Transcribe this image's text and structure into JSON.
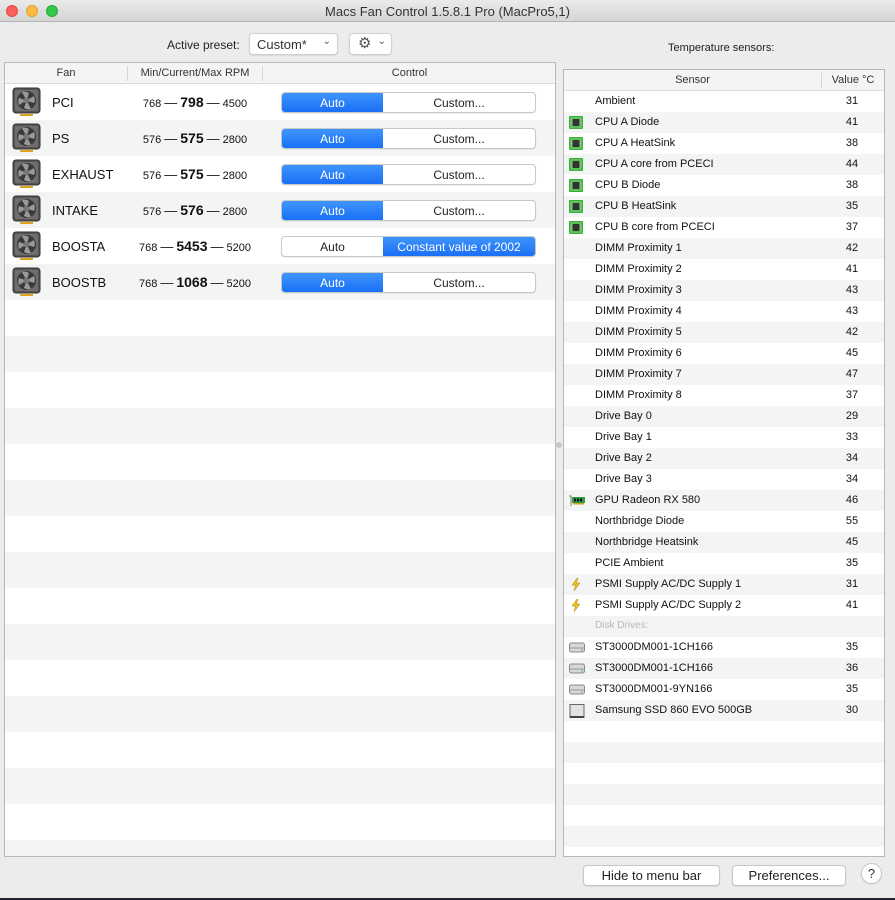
{
  "window": {
    "title": "Macs Fan Control 1.5.8.1 Pro (MacPro5,1)"
  },
  "toolbar": {
    "preset_label": "Active preset:",
    "preset_value": "Custom*",
    "gear_icon": "gear-icon"
  },
  "fans_table": {
    "columns": [
      "Fan",
      "Min/Current/Max RPM",
      "Control"
    ],
    "rows": [
      {
        "name": "PCI",
        "min": "768",
        "current": "798",
        "max": "4500",
        "mode": "auto",
        "auto_label": "Auto",
        "custom_label": "Custom..."
      },
      {
        "name": "PS",
        "min": "576",
        "current": "575",
        "max": "2800",
        "mode": "auto",
        "auto_label": "Auto",
        "custom_label": "Custom..."
      },
      {
        "name": "EXHAUST",
        "min": "576",
        "current": "575",
        "max": "2800",
        "mode": "auto",
        "auto_label": "Auto",
        "custom_label": "Custom..."
      },
      {
        "name": "INTAKE",
        "min": "576",
        "current": "576",
        "max": "2800",
        "mode": "auto",
        "auto_label": "Auto",
        "custom_label": "Custom..."
      },
      {
        "name": "BOOSTA",
        "min": "768",
        "current": "5453",
        "max": "5200",
        "mode": "custom",
        "auto_label": "Auto",
        "custom_label": "Constant value of 2002"
      },
      {
        "name": "BOOSTB",
        "min": "768",
        "current": "1068",
        "max": "5200",
        "mode": "auto",
        "auto_label": "Auto",
        "custom_label": "Custom..."
      }
    ],
    "dash": "—"
  },
  "sensors": {
    "label": "Temperature sensors:",
    "columns": [
      "Sensor",
      "Value °C"
    ],
    "rows": [
      {
        "icon": "none",
        "name": "Ambient",
        "value": "31"
      },
      {
        "icon": "cpu-chip",
        "name": "CPU A Diode",
        "value": "41"
      },
      {
        "icon": "cpu-chip",
        "name": "CPU A HeatSink",
        "value": "38"
      },
      {
        "icon": "cpu-chip",
        "name": "CPU A core from PCECI",
        "value": "44"
      },
      {
        "icon": "cpu-chip",
        "name": "CPU B Diode",
        "value": "38"
      },
      {
        "icon": "cpu-chip",
        "name": "CPU B HeatSink",
        "value": "35"
      },
      {
        "icon": "cpu-chip",
        "name": "CPU B core from PCECI",
        "value": "37"
      },
      {
        "icon": "none",
        "name": "DIMM Proximity 1",
        "value": "42"
      },
      {
        "icon": "none",
        "name": "DIMM Proximity 2",
        "value": "41"
      },
      {
        "icon": "none",
        "name": "DIMM Proximity 3",
        "value": "43"
      },
      {
        "icon": "none",
        "name": "DIMM Proximity 4",
        "value": "43"
      },
      {
        "icon": "none",
        "name": "DIMM Proximity 5",
        "value": "42"
      },
      {
        "icon": "none",
        "name": "DIMM Proximity 6",
        "value": "45"
      },
      {
        "icon": "none",
        "name": "DIMM Proximity 7",
        "value": "47"
      },
      {
        "icon": "none",
        "name": "DIMM Proximity 8",
        "value": "37"
      },
      {
        "icon": "none",
        "name": "Drive Bay 0",
        "value": "29"
      },
      {
        "icon": "none",
        "name": "Drive Bay 1",
        "value": "33"
      },
      {
        "icon": "none",
        "name": "Drive Bay 2",
        "value": "34"
      },
      {
        "icon": "none",
        "name": "Drive Bay 3",
        "value": "34"
      },
      {
        "icon": "gpu-card",
        "name": "GPU Radeon RX 580",
        "value": "46"
      },
      {
        "icon": "none",
        "name": "Northbridge Diode",
        "value": "55"
      },
      {
        "icon": "none",
        "name": "Northbridge Heatsink",
        "value": "45"
      },
      {
        "icon": "none",
        "name": "PCIE Ambient",
        "value": "35"
      },
      {
        "icon": "power-bolt",
        "name": "PSMI Supply AC/DC Supply 1",
        "value": "31"
      },
      {
        "icon": "power-bolt",
        "name": "PSMI Supply AC/DC Supply 2",
        "value": "41"
      },
      {
        "icon": "none",
        "name": "Disk Drives:",
        "value": "",
        "group": true
      },
      {
        "icon": "hard-drive",
        "name": "ST3000DM001-1CH166",
        "value": "35"
      },
      {
        "icon": "hard-drive",
        "name": "ST3000DM001-1CH166",
        "value": "36"
      },
      {
        "icon": "hard-drive",
        "name": "ST3000DM001-9YN166",
        "value": "35"
      },
      {
        "icon": "ssd-drive",
        "name": "Samsung SSD 860 EVO 500GB",
        "value": "30"
      }
    ]
  },
  "footer": {
    "hide_label": "Hide to menu bar",
    "prefs_label": "Preferences...",
    "help_label": "?"
  },
  "colors": {
    "accent": "#1a6ff5",
    "window_bg": "#ececec",
    "stripe": "#f3f4f4"
  }
}
